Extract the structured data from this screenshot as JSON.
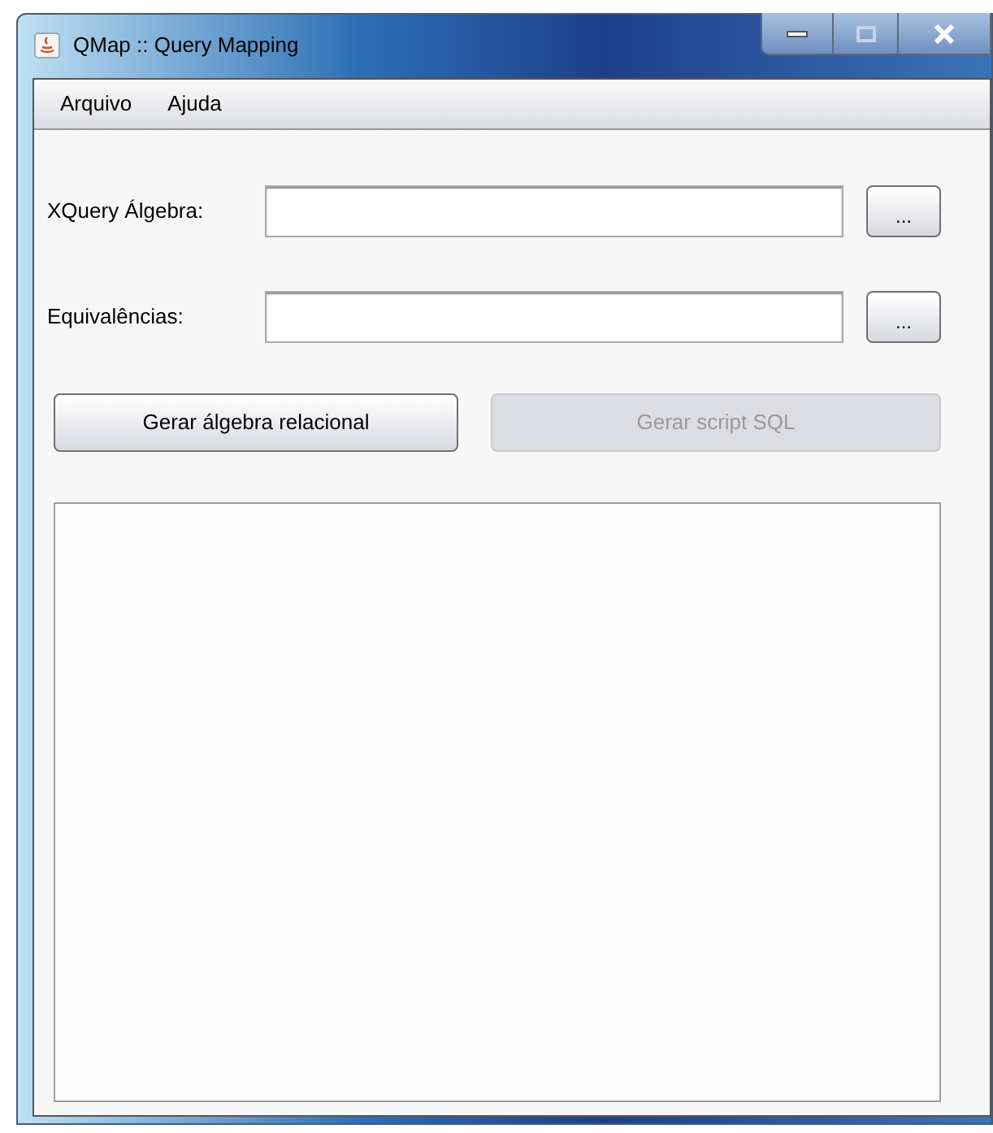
{
  "window": {
    "title": "QMap :: Query Mapping"
  },
  "menu": [
    {
      "label": "Arquivo"
    },
    {
      "label": "Ajuda"
    }
  ],
  "fields": [
    {
      "label": "XQuery Álgebra:",
      "button": "..."
    },
    {
      "label": "Equivalências:",
      "button": "..."
    }
  ],
  "actions": [
    {
      "label": "Gerar álgebra relacional",
      "disabled": false
    },
    {
      "label": "Gerar script SQL",
      "disabled": true
    }
  ]
}
